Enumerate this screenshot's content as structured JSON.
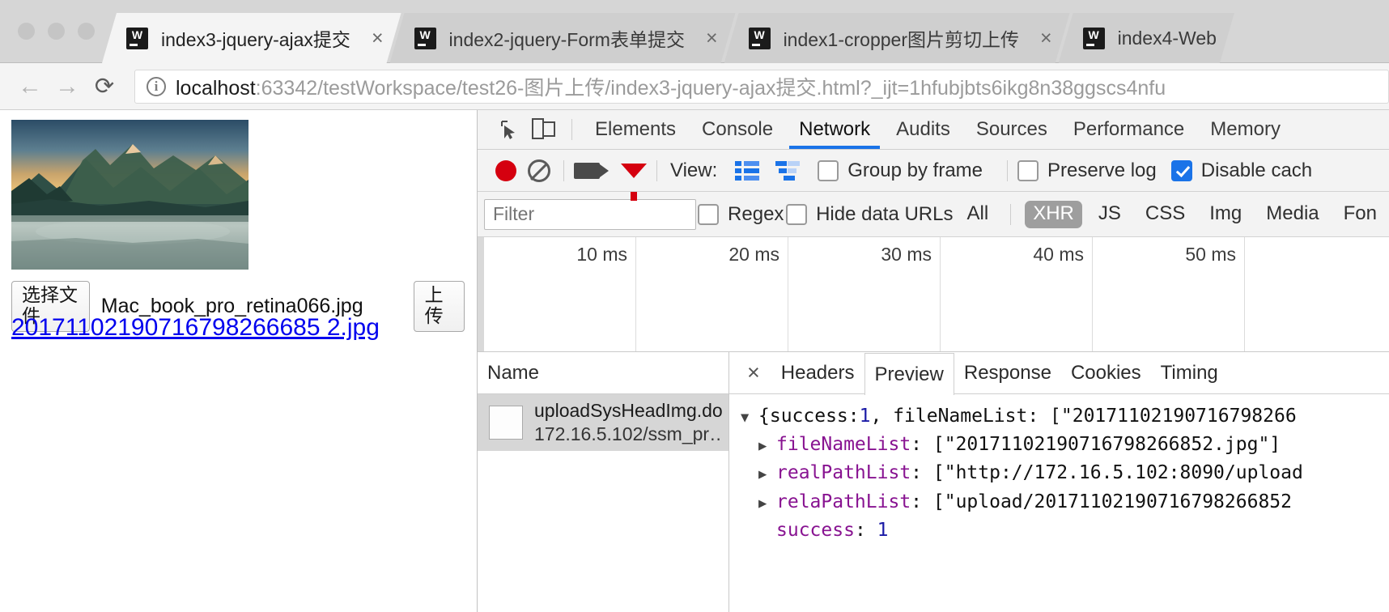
{
  "browser": {
    "tabs": [
      {
        "title": "index3-jquery-ajax提交",
        "icon": "webstorm-icon",
        "active": true,
        "close": "×"
      },
      {
        "title": "index2-jquery-Form表单提交",
        "icon": "webstorm-icon",
        "active": false,
        "close": "×"
      },
      {
        "title": "index1-cropper图片剪切上传",
        "icon": "webstorm-icon",
        "active": false,
        "close": "×"
      },
      {
        "title": "index4-Web",
        "icon": "webstorm-icon",
        "active": false,
        "close": ""
      }
    ],
    "nav": {
      "back": "←",
      "forward": "→",
      "reload": "⟳"
    },
    "omnibox": {
      "security_icon": "info-icon",
      "host": "localhost",
      "path": ":63342/testWorkspace/test26-图片上传/index3-jquery-ajax提交.html?_ijt=1hfubjbts6ikg8n38ggscs4nfu"
    }
  },
  "page": {
    "choose_file_button": "选择文件",
    "file_name": "Mac_book_pro_retina066.jpg",
    "upload_button": "上传",
    "result_link": "20171102190716798266685 2.jpg"
  },
  "devtools": {
    "panel_tabs": [
      {
        "label": "Elements",
        "active": false
      },
      {
        "label": "Console",
        "active": false
      },
      {
        "label": "Network",
        "active": true
      },
      {
        "label": "Audits",
        "active": false
      },
      {
        "label": "Sources",
        "active": false
      },
      {
        "label": "Performance",
        "active": false
      },
      {
        "label": "Memory",
        "active": false
      }
    ],
    "toolbar": {
      "record_icon": "record-icon",
      "clear_icon": "clear-icon",
      "capture_screenshots_icon": "camera-icon",
      "filter_icon": "funnel-icon",
      "view_label": "View:",
      "view_list_icon": "list-view-icon",
      "view_waterfall_icon": "waterfall-view-icon",
      "group_by_frame": {
        "label": "Group by frame",
        "checked": false
      },
      "preserve_log": {
        "label": "Preserve log",
        "checked": false
      },
      "disable_cache": {
        "label": "Disable cach",
        "checked": true
      }
    },
    "filterbar": {
      "filter_placeholder": "Filter",
      "filter_value": "",
      "regex": {
        "label": "Regex",
        "checked": false
      },
      "hide_data_urls": {
        "label": "Hide data URLs",
        "checked": false
      },
      "types": [
        {
          "label": "All",
          "active": false
        },
        {
          "label": "XHR",
          "active": true
        },
        {
          "label": "JS",
          "active": false
        },
        {
          "label": "CSS",
          "active": false
        },
        {
          "label": "Img",
          "active": false
        },
        {
          "label": "Media",
          "active": false
        },
        {
          "label": "Fon",
          "active": false
        }
      ]
    },
    "overview": {
      "ticks": [
        "10 ms",
        "20 ms",
        "30 ms",
        "40 ms",
        "50 ms"
      ]
    },
    "requests": {
      "column_header": "Name",
      "rows": [
        {
          "name": "uploadSysHeadImg.do",
          "subtitle": "172.16.5.102/ssm_pr…",
          "selected": true
        }
      ]
    },
    "detail": {
      "close_label": "×",
      "tabs": [
        {
          "label": "Headers",
          "active": false
        },
        {
          "label": "Preview",
          "active": true
        },
        {
          "label": "Response",
          "active": false
        },
        {
          "label": "Cookies",
          "active": false
        },
        {
          "label": "Timing",
          "active": false
        }
      ],
      "preview": {
        "root_line_prefix": "{success: ",
        "root_success": "1",
        "root_line_mid": ", fileNameList: [\"20171102190716798266",
        "rows": [
          {
            "tri": "▶",
            "key": "fileNameList",
            "value": "[\"20171102190716798266852.jpg\"]"
          },
          {
            "tri": "▶",
            "key": "realPathList",
            "value": "[\"http://172.16.5.102:8090/upload"
          },
          {
            "tri": "▶",
            "key": "relaPathList",
            "value": "[\"upload/20171102190716798266852"
          }
        ],
        "success_key": "success",
        "success_value": "1"
      }
    }
  },
  "colors": {
    "accent": "#1a73e8",
    "record": "#d5000f",
    "link": "#0000ee",
    "json_key": "#881391",
    "json_number": "#1a1aa6"
  }
}
